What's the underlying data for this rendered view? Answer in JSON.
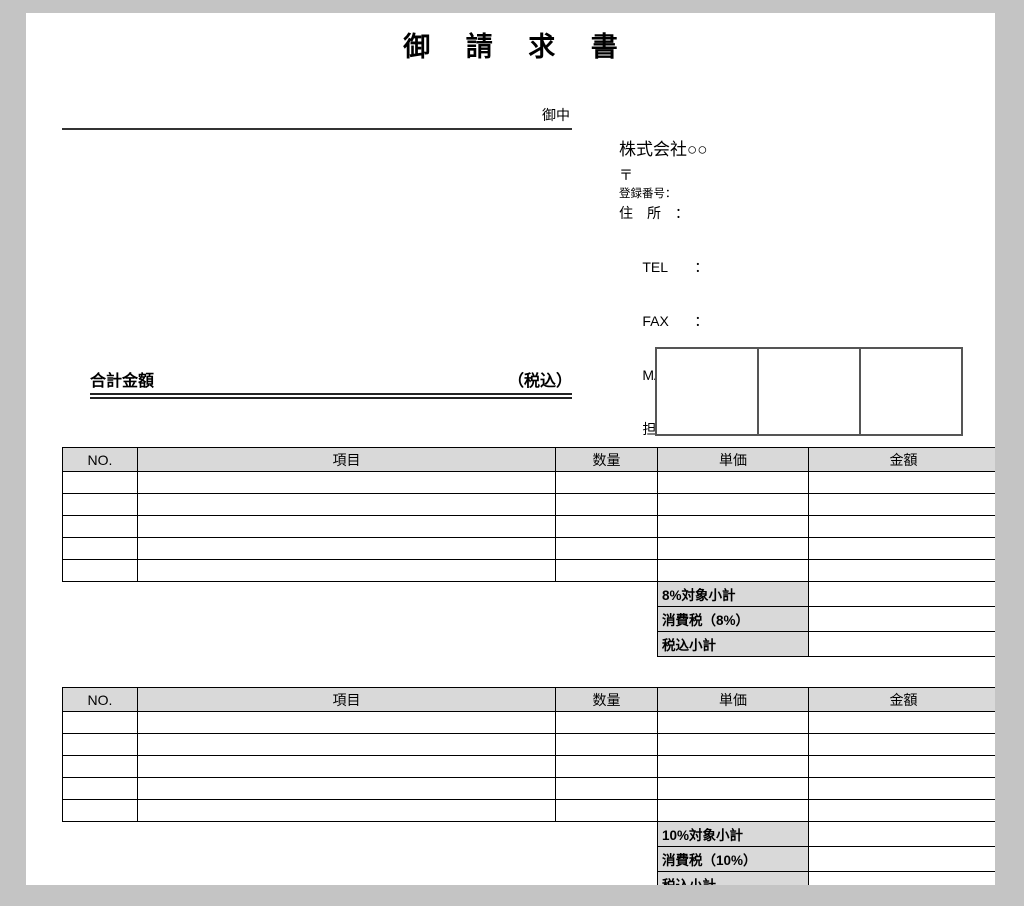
{
  "document": {
    "title": "御 請 求 書",
    "title_plain": "御請求書"
  },
  "customer": {
    "honorific": "御中"
  },
  "seller": {
    "company_name": "株式会社○○",
    "postal_symbol": "〒",
    "registration_number_label": "登録番号：",
    "address_label": "住　所　：",
    "tel_label": "TEL",
    "fax_label": "FAX",
    "mail_label": "MAIL",
    "staff_label": "担　当",
    "colon": "：",
    "tel_value": "",
    "fax_value": "",
    "mail_value": "",
    "staff_value": ""
  },
  "total": {
    "label": "合計金額",
    "tax_note": "（税込）",
    "value": ""
  },
  "stamps": {
    "boxes": [
      "",
      "",
      ""
    ]
  },
  "tables": [
    {
      "id": "table1",
      "headers": [
        "NO.",
        "項目",
        "数量",
        "単価",
        "金額"
      ],
      "rows": [
        {
          "no": "",
          "item": "",
          "qty": "",
          "price": "",
          "amount": ""
        },
        {
          "no": "",
          "item": "",
          "qty": "",
          "price": "",
          "amount": ""
        },
        {
          "no": "",
          "item": "",
          "qty": "",
          "price": "",
          "amount": ""
        },
        {
          "no": "",
          "item": "",
          "qty": "",
          "price": "",
          "amount": ""
        },
        {
          "no": "",
          "item": "",
          "qty": "",
          "price": "",
          "amount": ""
        }
      ],
      "subtotals": [
        {
          "label": "8%対象小計",
          "value": ""
        },
        {
          "label": "消費税（8%）",
          "value": ""
        },
        {
          "label": "税込小計",
          "value": ""
        }
      ]
    },
    {
      "id": "table2",
      "headers": [
        "NO.",
        "項目",
        "数量",
        "単価",
        "金額"
      ],
      "rows": [
        {
          "no": "",
          "item": "",
          "qty": "",
          "price": "",
          "amount": ""
        },
        {
          "no": "",
          "item": "",
          "qty": "",
          "price": "",
          "amount": ""
        },
        {
          "no": "",
          "item": "",
          "qty": "",
          "price": "",
          "amount": ""
        },
        {
          "no": "",
          "item": "",
          "qty": "",
          "price": "",
          "amount": ""
        },
        {
          "no": "",
          "item": "",
          "qty": "",
          "price": "",
          "amount": ""
        }
      ],
      "subtotals": [
        {
          "label": "10%対象小計",
          "value": ""
        },
        {
          "label": "消費税（10%）",
          "value": ""
        },
        {
          "label": "税込小計",
          "value": ""
        }
      ]
    }
  ],
  "colors": {
    "page_background": "#c4c4c4",
    "paper": "#ffffff",
    "header_fill": "#d9d9d9",
    "border": "#000000"
  }
}
